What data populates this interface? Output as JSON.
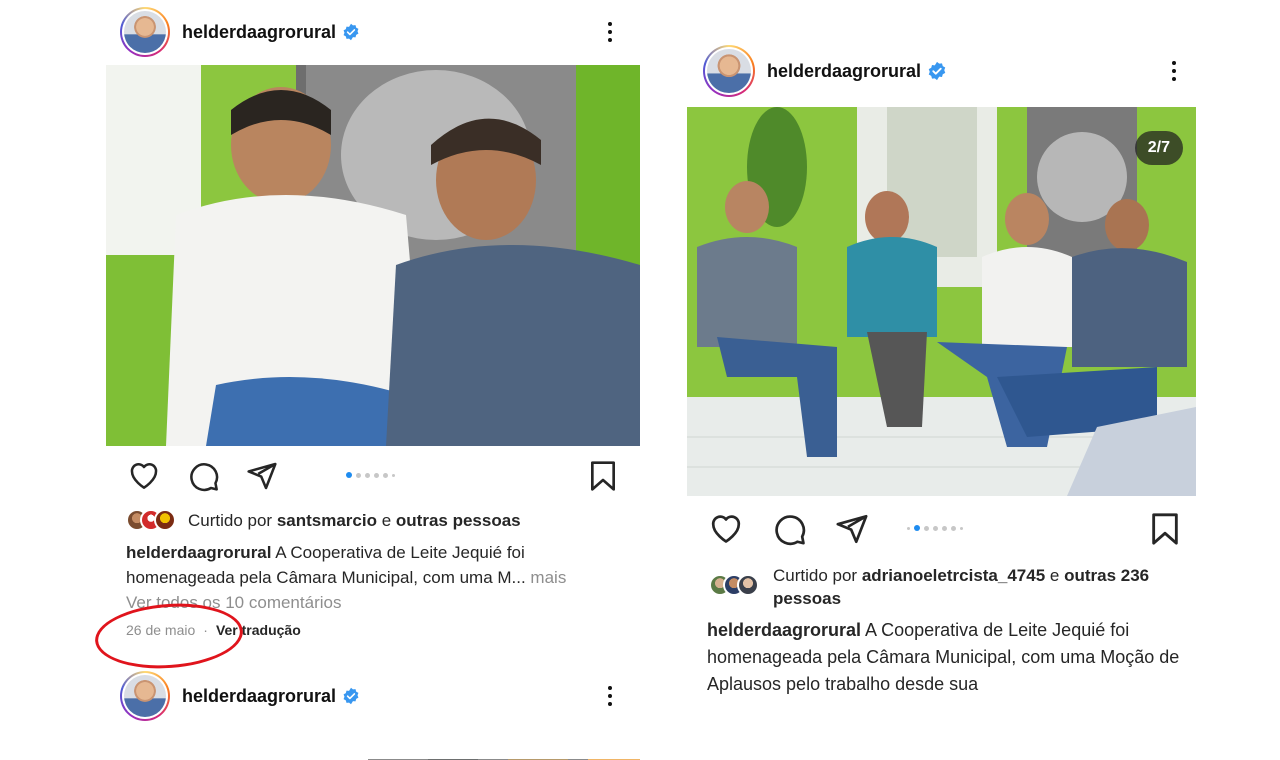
{
  "left_post": {
    "username": "helderdaagrorural",
    "likes_prefix": "Curtido por ",
    "likes_user": "santsmarcio",
    "likes_mid": " e ",
    "likes_others": "outras pessoas",
    "caption_user": "helderdaagrorural",
    "caption_text": " A Cooperativa de Leite Jequié foi homenageada pela Câmara Municipal, com uma M...",
    "caption_more": " mais",
    "comments_link": "Ver todos os 10 comentários",
    "date": "26 de maio",
    "separator": "·",
    "translate_link": "Ver tradução",
    "carousel_total": 6,
    "carousel_index": 1
  },
  "left_next_post": {
    "username": "helderdaagrorural"
  },
  "right_post": {
    "username": "helderdaagrorural",
    "slide_counter": "2/7",
    "likes_prefix": "Curtido por ",
    "likes_user": "adrianoeletrcista_4745",
    "likes_mid": " e ",
    "likes_others": "outras 236 pessoas",
    "caption_user": "helderdaagrorural",
    "caption_text": " A Cooperativa de Leite Jequié foi homenageada pela Câmara Municipal, com uma Moção de Aplausos pelo trabalho desde sua",
    "carousel_total": 7,
    "carousel_index": 2
  },
  "icons": {
    "like": "heart-icon",
    "comment": "comment-icon",
    "share": "paper-plane-icon",
    "save": "bookmark-icon",
    "options": "more-vertical-icon",
    "verified": "verified-badge-icon"
  },
  "colors": {
    "verified_blue": "#3897f0",
    "annotation_red": "#e0141c",
    "wall_green": "#7cc32a"
  }
}
